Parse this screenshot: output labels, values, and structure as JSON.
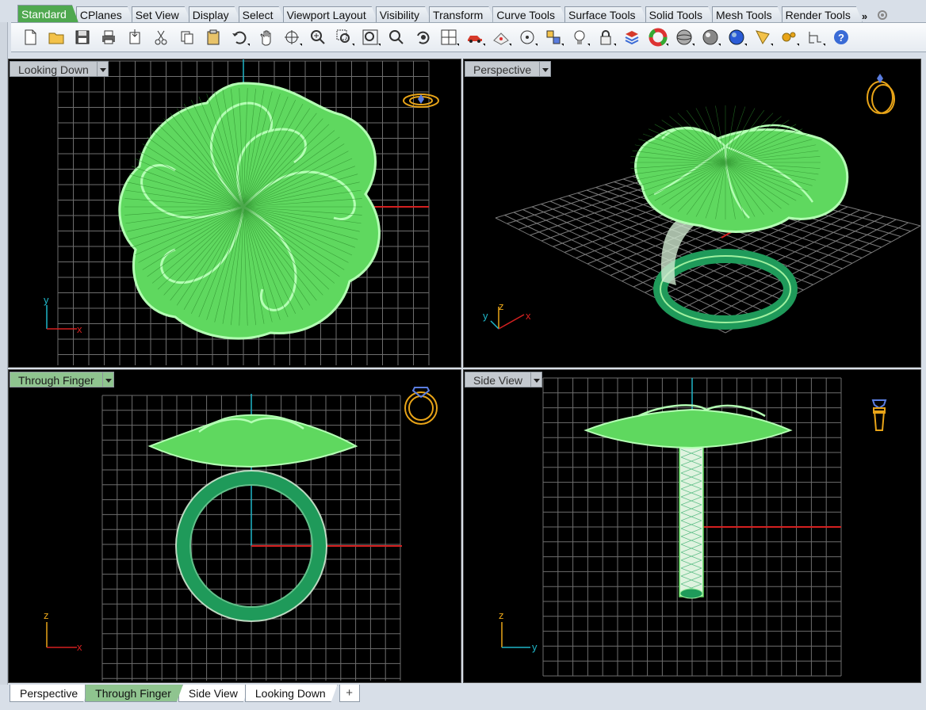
{
  "toolbar_tabs": [
    {
      "label": "Standard",
      "active": true
    },
    {
      "label": "CPlanes",
      "active": false
    },
    {
      "label": "Set View",
      "active": false
    },
    {
      "label": "Display",
      "active": false
    },
    {
      "label": "Select",
      "active": false
    },
    {
      "label": "Viewport Layout",
      "active": false
    },
    {
      "label": "Visibility",
      "active": false
    },
    {
      "label": "Transform",
      "active": false
    },
    {
      "label": "Curve Tools",
      "active": false
    },
    {
      "label": "Surface Tools",
      "active": false
    },
    {
      "label": "Solid Tools",
      "active": false
    },
    {
      "label": "Mesh Tools",
      "active": false
    },
    {
      "label": "Render Tools",
      "active": false
    }
  ],
  "tab_overflow": "»",
  "tools": [
    "new-document-icon",
    "open-folder-icon",
    "save-icon",
    "print-icon",
    "import-icon",
    "cut-icon",
    "copy-icon",
    "paste-icon",
    "undo-icon",
    "pan-hand-icon",
    "rotate-view-icon",
    "zoom-dynamic-icon",
    "zoom-window-icon",
    "zoom-extents-icon",
    "zoom-selected-icon",
    "undo-view-icon",
    "four-viewports-icon",
    "car-icon",
    "grid-snap-icon",
    "circle-osnap-icon",
    "properties-icon",
    "light-bulb-icon",
    "lock-icon",
    "layer-book-icon",
    "color-wheel-icon",
    "sphere-shaded-icon",
    "sphere-rendered-icon",
    "sphere-blue-icon",
    "analyze-icon",
    "gears-icon",
    "tree-icon",
    "help-icon"
  ],
  "viewports": {
    "top": {
      "title": "Looking Down",
      "active": false,
      "axes": {
        "a": "y",
        "b": "x"
      }
    },
    "persp": {
      "title": "Perspective",
      "active": false,
      "axes": {
        "a": "y",
        "b": "z",
        "c": "x"
      }
    },
    "front": {
      "title": "Through Finger",
      "active": true,
      "axes": {
        "a": "z",
        "b": "x"
      }
    },
    "side": {
      "title": "Side View",
      "active": false,
      "axes": {
        "a": "z",
        "b": "y"
      }
    }
  },
  "viewport_tabs": [
    {
      "label": "Perspective",
      "active": false
    },
    {
      "label": "Through Finger",
      "active": true
    },
    {
      "label": "Side View",
      "active": false
    },
    {
      "label": "Looking Down",
      "active": false
    }
  ],
  "viewport_tab_add": "+",
  "colors": {
    "grid": "#7a7a7a",
    "model": "#6fe86f",
    "model_dark": "#1f9a5a",
    "x_axis": "#d42020",
    "y_axis": "#1fb6c8",
    "gumball": "#e8a418",
    "active_tab": "#8fc48f"
  }
}
